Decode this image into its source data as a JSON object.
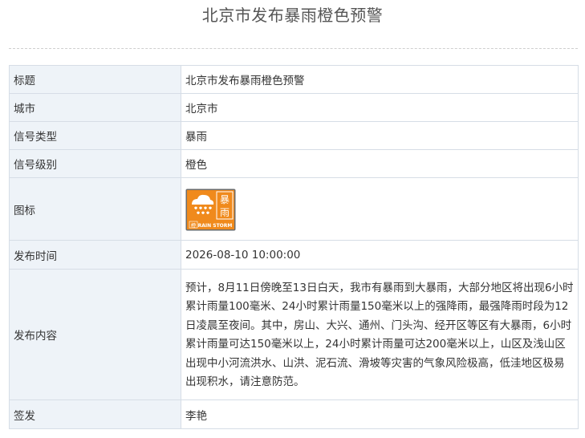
{
  "page": {
    "title": "北京市发布暴雨橙色预警"
  },
  "table": {
    "rows": [
      {
        "label": "标题",
        "value": "北京市发布暴雨橙色预警"
      },
      {
        "label": "城市",
        "value": "北京市"
      },
      {
        "label": "信号类型",
        "value": "暴雨"
      },
      {
        "label": "信号级别",
        "value": "橙色"
      },
      {
        "label": "图标",
        "icon": "rainstorm-orange-warning-icon"
      },
      {
        "label": "发布时间",
        "value": "2026-08-10 10:00:00"
      },
      {
        "label": "发布内容",
        "value": "预计，8月11日傍晚至13日白天，我市有暴雨到大暴雨，大部分地区将出现6小时累计雨量100毫米、24小时累计雨量150毫米以上的强降雨，最强降雨时段为12日凌晨至夜间。其中，房山、大兴、通州、门头沟、经开区等区有大暴雨，6小时累计雨量可达150毫米以上，24小时累计雨量可达200毫米以上，山区及浅山区出现中小河流洪水、山洪、泥石流、滑坡等灾害的气象风险极高，低洼地区极易出现积水，请注意防范。"
      },
      {
        "label": "签发",
        "value": "李艳"
      }
    ]
  },
  "icon": {
    "char_top": "暴",
    "char_bottom": "雨",
    "char_small": "橙",
    "caption": "RAIN STORM",
    "colors": {
      "background": "#f08a1c",
      "border": "#6b6b6b",
      "panel": "#ffffff"
    }
  },
  "colors": {
    "label_background": "#eef3f8",
    "border": "#d6dde6",
    "title_text": "#555555",
    "body_text": "#333333"
  }
}
